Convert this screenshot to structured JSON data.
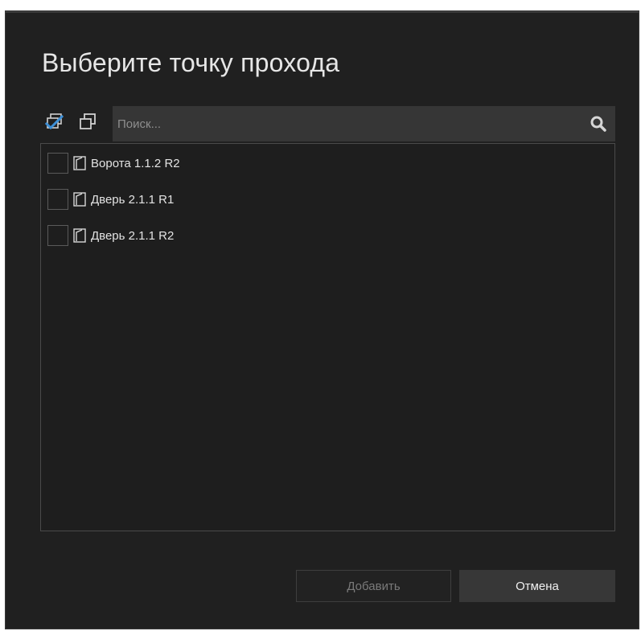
{
  "dialog": {
    "title": "Выберите точку прохода"
  },
  "toolbar": {
    "check_all_icon": "check-all-icon",
    "uncheck_all_icon": "uncheck-all-icon",
    "search": {
      "placeholder": "Поиск...",
      "value": "",
      "icon": "search-icon"
    }
  },
  "list": {
    "items": [
      {
        "label": "Ворота 1.1.2 R2",
        "checked": false,
        "icon": "door-icon"
      },
      {
        "label": "Дверь 2.1.1 R1",
        "checked": false,
        "icon": "door-icon"
      },
      {
        "label": "Дверь 2.1.1 R2",
        "checked": false,
        "icon": "door-icon"
      }
    ]
  },
  "buttons": {
    "add_label": "Добавить",
    "add_enabled": false,
    "cancel_label": "Отмена"
  },
  "colors": {
    "background": "#202020",
    "accent_blue": "#3d8fd6",
    "text": "#e3e3e3",
    "disabled_text": "#7a7a7a"
  }
}
